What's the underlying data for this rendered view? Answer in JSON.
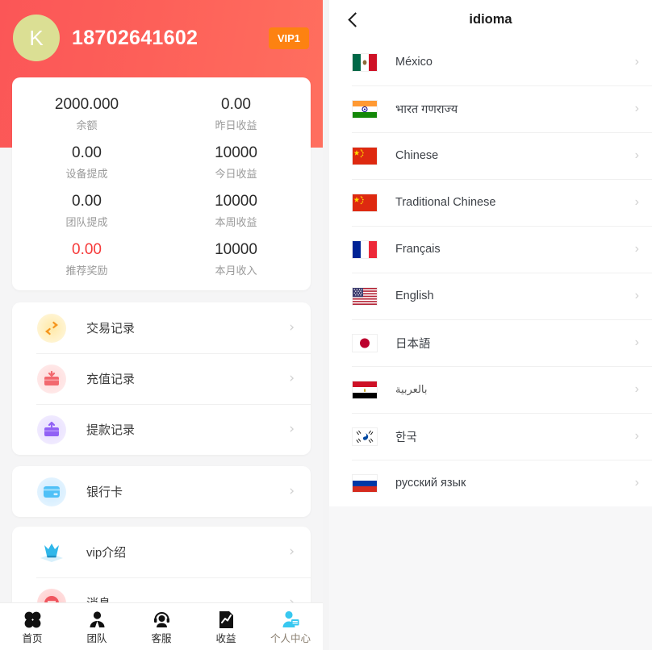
{
  "left": {
    "header": {
      "avatar_letter": "K",
      "phone": "18702641602",
      "vip_badge": "VIP1"
    },
    "stats": [
      {
        "value": "2000.000",
        "label": "余额",
        "color": "#2b2b2b"
      },
      {
        "value": "0.00",
        "label": "昨日收益",
        "color": "#2b2b2b"
      },
      {
        "value": "0.00",
        "label": "设备提成",
        "color": "#2b2b2b"
      },
      {
        "value": "10000",
        "label": "今日收益",
        "color": "#2b2b2b"
      },
      {
        "value": "0.00",
        "label": "团队提成",
        "color": "#2b2b2b"
      },
      {
        "value": "10000",
        "label": "本周收益",
        "color": "#2b2b2b"
      },
      {
        "value": "0.00",
        "label": "推荐奖励",
        "color": "#f63a3a"
      },
      {
        "value": "10000",
        "label": "本月收入",
        "color": "#2b2b2b"
      }
    ],
    "menu_group_1": [
      {
        "label": "交易记录",
        "icon": "exchange-icon"
      },
      {
        "label": "充值记录",
        "icon": "deposit-icon"
      },
      {
        "label": "提款记录",
        "icon": "withdraw-icon"
      }
    ],
    "menu_group_2": [
      {
        "label": "银行卡",
        "icon": "bank-card-icon"
      }
    ],
    "menu_group_3": [
      {
        "label": "vip介绍",
        "icon": "vip-intro-icon"
      },
      {
        "label": "消息",
        "icon": "message-icon"
      }
    ],
    "tabs": [
      {
        "label": "首页",
        "icon": "grid-icon",
        "active": false
      },
      {
        "label": "团队",
        "icon": "team-icon",
        "active": false
      },
      {
        "label": "客服",
        "icon": "headset-icon",
        "active": false
      },
      {
        "label": "收益",
        "icon": "chart-icon",
        "active": false
      },
      {
        "label": "个人中心",
        "icon": "person-card-icon",
        "active": true
      }
    ]
  },
  "right": {
    "header": {
      "back_icon": "back-chevron-icon",
      "title": "idioma"
    },
    "languages": [
      {
        "name": "México",
        "flag": "mx"
      },
      {
        "name": "भारत गणराज्य",
        "flag": "in"
      },
      {
        "name": "Chinese",
        "flag": "cn"
      },
      {
        "name": "Traditional Chinese",
        "flag": "cn"
      },
      {
        "name": "Français",
        "flag": "fr"
      },
      {
        "name": "English",
        "flag": "us"
      },
      {
        "name": "日本語",
        "flag": "jp"
      },
      {
        "name": "بالعربية",
        "flag": "eg",
        "rtl": true
      },
      {
        "name": "한국",
        "flag": "kr"
      },
      {
        "name": "русский язык",
        "flag": "ru"
      }
    ],
    "chevron": "›"
  },
  "colors": {
    "hero_start": "#fb5657",
    "hero_end": "#ff6f5f",
    "accent_vip": "#fd8211",
    "danger": "#f63a3a",
    "tab_active": "#38c8f0",
    "page_bg": "#f5f5f6"
  }
}
